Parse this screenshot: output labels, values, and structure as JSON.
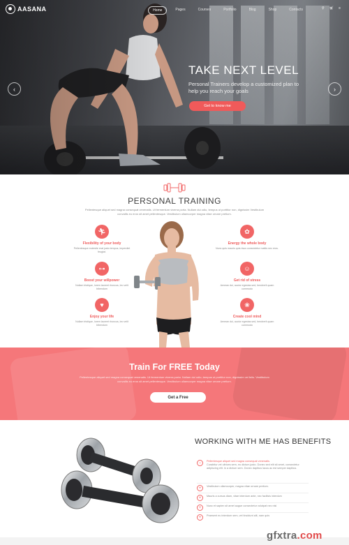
{
  "brand": {
    "name": "AASANA"
  },
  "nav": {
    "items": [
      "Home",
      "Pages",
      "Courses",
      "Portfolio",
      "Blog",
      "Shop",
      "Contacts"
    ],
    "active": "Home"
  },
  "hero": {
    "title": "TAKE NEXT LEVEL",
    "subtitle": "Personal Trainers develop a customized plan to help you reach your goals",
    "button": "Get to know me",
    "prev_arrow": "‹",
    "next_arrow": "›"
  },
  "personal_training": {
    "title": "PERSONAL TRAINING",
    "text": "Pellentesque aliquet sed magna consequat venenatis. Ut fermentum viverra porta. Nullam dui odio, tempus ut porttitor non, dignissim Vestibulum convallis eu eros sit amet pellentesque. Vestibulum ullamcorper magna vitae ornare pretium.",
    "features_left": [
      {
        "icon": "runner-icon",
        "title": "Flexibility of your body",
        "text": "Pellentesque molestie erat justo tempus, imperdiet feugiat."
      },
      {
        "icon": "dumbbell-icon",
        "title": "Boost your willpower",
        "text": "Nullam tristique, lorem laoreet rhoncus, leo velit bibendum"
      },
      {
        "icon": "heart-icon",
        "title": "Enjoy your life",
        "text": "Nullam tristique, lorem laoreet rhoncus, leo velit bibendum"
      }
    ],
    "features_right": [
      {
        "icon": "apple-icon",
        "title": "Energy the whole body",
        "text": "Nunc quis mauris quis risus consectetur mattis nec eros."
      },
      {
        "icon": "meditation-icon",
        "title": "Get rid of stress",
        "text": "Aenean dui, auctor egestas sed, hendrerit quam commodo"
      },
      {
        "icon": "lotus-icon",
        "title": "Create cool mind",
        "text": "Aenean dui, auctor egestas sed, hendrerit quam commodo"
      }
    ]
  },
  "free": {
    "title": "Train For FREE Today",
    "text": "Pellentesque aliquet sed magna consequat venenatis. Ut fermentum viverra porta. Nullam dui odio, tempus ut porttitor non, dignissim vel felis. Vestibulum convallis eu eros sit amet pellentesque. Vestibulum ullamcorper magna vitae ornare pretium.",
    "button": "Get a Free"
  },
  "benefits": {
    "title": "WORKING WITH ME HAS BENEFITS",
    "items": [
      {
        "highlight": "Pellentesque aliquet sed magna consequat venenatis.",
        "text": "Curabitur vel ultrices sem, eu dictum justo. Donec sed elit sit amet, consectetur adipiscing elit. In a dictum sem. Donec dapibus lacus ac est semper dapibus."
      },
      {
        "highlight": "Vestibulum ullamcorper, magna vitae ornare pretium.",
        "text": ""
      },
      {
        "highlight": "Mauris a cursus diam, vitae interdum ante, nec facilisis interdum",
        "text": ""
      },
      {
        "highlight": "Nunc et sapien sit amet augue consectetur volutpat nec nisl",
        "text": ""
      },
      {
        "highlight": "Praesent eu interdum sem, vel tincidunt alit, nam quis",
        "text": ""
      }
    ]
  },
  "watermark": {
    "text": "gfxtra",
    "suffix": ".com"
  },
  "colors": {
    "accent": "#f16565",
    "banner": "#f5777a"
  }
}
